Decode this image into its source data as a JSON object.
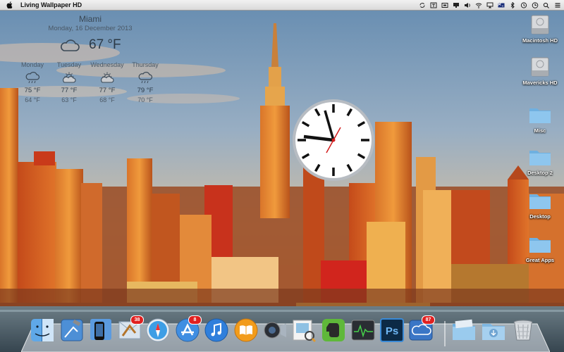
{
  "menubar": {
    "app_name": "Living Wallpaper HD",
    "status_icons": [
      "sync-icon",
      "text-icon",
      "screen-icon",
      "display-icon",
      "volume-icon",
      "wifi-icon",
      "airplay-icon",
      "flag-icon",
      "bluetooth-icon",
      "time-machine-icon",
      "clock-icon",
      "search-icon",
      "list-icon"
    ]
  },
  "weather": {
    "city": "Miami",
    "date": "Monday, 16 December 2013",
    "current_temp": "67 °F",
    "current_icon": "cloud-icon",
    "forecast": [
      {
        "day": "Monday",
        "high": "75 °F",
        "low": "64 °F",
        "icon": "cloud-rain-icon"
      },
      {
        "day": "Tuesday",
        "high": "77 °F",
        "low": "63 °F",
        "icon": "sun-cloud-icon"
      },
      {
        "day": "Wednesday",
        "high": "77 °F",
        "low": "68 °F",
        "icon": "sun-cloud-icon"
      },
      {
        "day": "Thursday",
        "high": "79 °F",
        "low": "70 °F",
        "icon": "cloud-rain-icon"
      }
    ]
  },
  "desktop_icons": [
    {
      "label": "Macintosh HD",
      "icon": "hard-drive-icon"
    },
    {
      "label": "Mavericks HD",
      "icon": "hard-drive-icon"
    },
    {
      "label": "Misc",
      "icon": "folder-icon"
    },
    {
      "label": "Desktop 2",
      "icon": "folder-icon"
    },
    {
      "label": "Desktop",
      "icon": "folder-icon"
    },
    {
      "label": "Great Apps",
      "icon": "folder-icon"
    }
  ],
  "dock": {
    "badges": {
      "mail": "38",
      "app_store": "8",
      "cloud": "87"
    },
    "apps": [
      "finder",
      "xcode",
      "simulator",
      "mail",
      "safari",
      "app-store",
      "itunes",
      "ibooks",
      "facetime",
      "preview",
      "evernote",
      "activity-monitor",
      "photoshop",
      "cloud",
      "downloads-folder",
      "documents-folder",
      "trash"
    ]
  },
  "colors": {
    "menubar": "#e6e6e6",
    "badge": "#e02020",
    "sky": "#88a7c3"
  }
}
